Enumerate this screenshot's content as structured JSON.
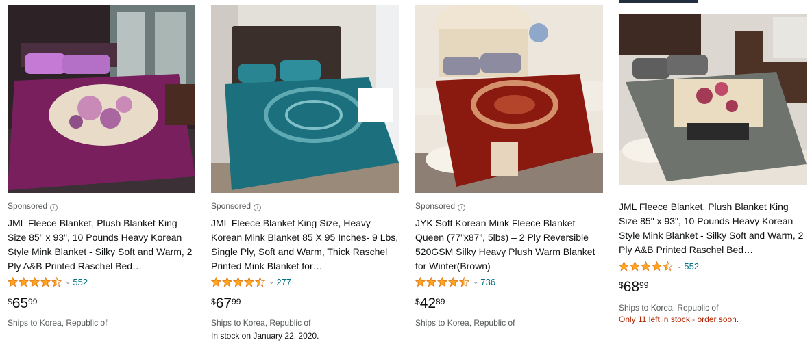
{
  "products": [
    {
      "sponsored": "Sponsored",
      "title": "JML Fleece Blanket, Plush Blanket King Size 85\" x 93\", 10 Pounds Heavy Korean Style Mink Blanket - Silky Soft and Warm, 2 Ply A&B Printed Raschel Bed…",
      "rating": 4.5,
      "review_count": "552",
      "price_symbol": "$",
      "price_whole": "65",
      "price_fraction": "99",
      "ships": "Ships to Korea, Republic of",
      "stock": "",
      "colors": {
        "bg": "#3a2a30",
        "blanket": "#7a1f5e",
        "accent": "#c98ab8",
        "pillow": "#b46fc7"
      }
    },
    {
      "sponsored": "Sponsored",
      "title": "JML Fleece Blanket King Size, Heavy Korean Mink Blanket 85 X 95 Inches- 9 Lbs, Single Ply, Soft and Warm, Thick Raschel Printed Mink Blanket for…",
      "rating": 4.5,
      "review_count": "277",
      "price_symbol": "$",
      "price_whole": "67",
      "price_fraction": "99",
      "ships": "Ships to Korea, Republic of",
      "stock": "In stock on January 22, 2020.",
      "colors": {
        "bg": "#d8d4cf",
        "blanket": "#1c6f7c",
        "accent": "#5fa9b3",
        "pillow": "#2a8593"
      }
    },
    {
      "sponsored": "Sponsored",
      "title": "JYK Soft Korean Mink Fleece Blanket Queen (77”x87”, 5lbs) – 2 Ply Reversible 520GSM Silky Heavy Plush Warm Blanket for Winter(Brown)",
      "rating": 4.5,
      "review_count": "736",
      "price_symbol": "$",
      "price_whole": "42",
      "price_fraction": "89",
      "ships": "Ships to Korea, Republic of",
      "stock": "",
      "colors": {
        "bg": "#e4ddd2",
        "blanket": "#8a1a0f",
        "accent": "#d3906a",
        "pillow": "#8c8ba0"
      }
    },
    {
      "sponsored": "",
      "title": "JML Fleece Blanket, Plush Blanket King Size 85\" x 93\", 10 Pounds Heavy Korean Style Mink Blanket - Silky Soft and Warm, 2 Ply A&B Printed Raschel Bed…",
      "rating": 4.5,
      "review_count": "552",
      "price_symbol": "$",
      "price_whole": "68",
      "price_fraction": "99",
      "ships": "Ships to Korea, Republic of",
      "stock": "Only 11 left in stock - order soon.",
      "colors": {
        "bg": "#d7d3cc",
        "blanket": "#6f736e",
        "accent": "#e9dcc1",
        "pillow": "#5e5e5e"
      }
    }
  ],
  "icons": {
    "star": "star-icon",
    "chevron": "chevron-down-icon",
    "info": "info-icon"
  },
  "colors": {
    "star": "#ffa41c",
    "link": "#007185",
    "stock_warning": "#b12704",
    "muted": "#565959"
  }
}
